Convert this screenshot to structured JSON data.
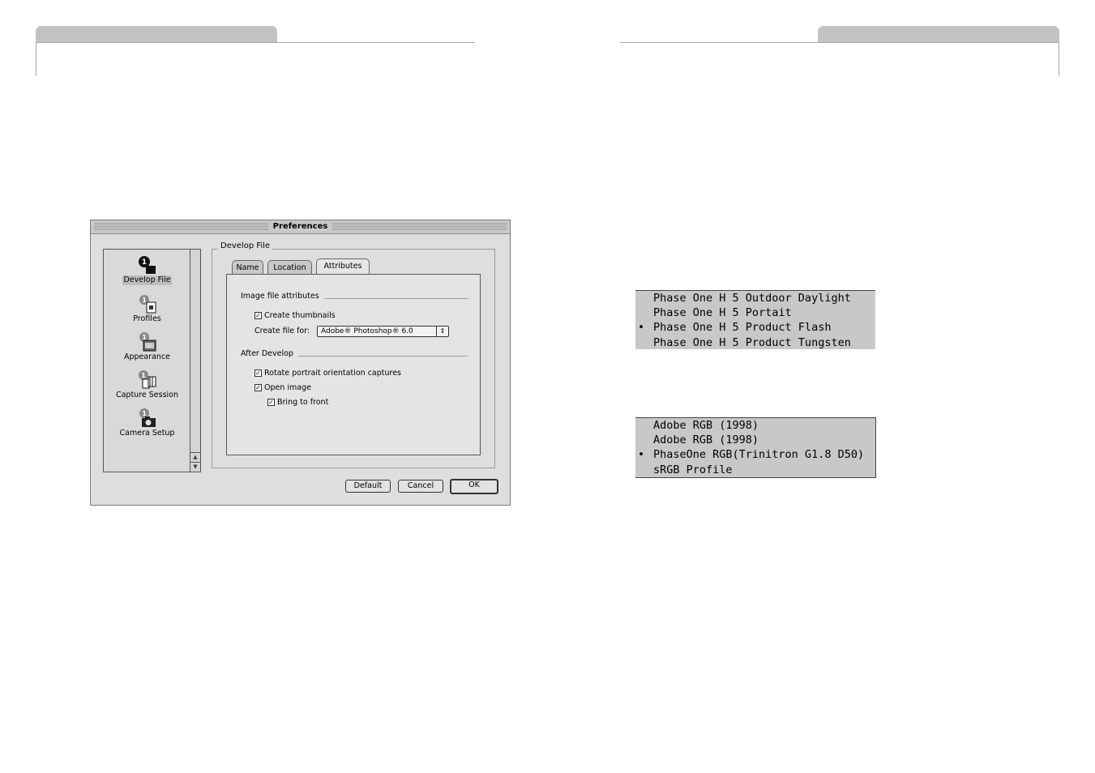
{
  "dialog": {
    "title": "Preferences",
    "sidebar": {
      "items": [
        {
          "label": "Develop File",
          "icon": "develop-file-icon",
          "selected": true
        },
        {
          "label": "Profiles",
          "icon": "profiles-icon",
          "selected": false
        },
        {
          "label": "Appearance",
          "icon": "appearance-icon",
          "selected": false
        },
        {
          "label": "Capture Session",
          "icon": "capture-session-icon",
          "selected": false
        },
        {
          "label": "Camera Setup",
          "icon": "camera-setup-icon",
          "selected": false
        }
      ]
    },
    "group_label": "Develop File",
    "tabs": [
      {
        "label": "Name",
        "active": false
      },
      {
        "label": "Location",
        "active": false
      },
      {
        "label": "Attributes",
        "active": true
      }
    ],
    "attributes": {
      "image_file_section": "Image file attributes",
      "create_thumbnails": {
        "label": "Create thumbnails",
        "checked": true
      },
      "create_file_for_label": "Create file for:",
      "create_file_for_value": "Adobe® Photoshop® 6.0",
      "after_develop_section": "After Develop",
      "rotate_portrait": {
        "label": "Rotate portrait orientation captures",
        "checked": true
      },
      "open_image": {
        "label": "Open image",
        "checked": true
      },
      "bring_to_front": {
        "label": "Bring to front",
        "checked": true
      }
    },
    "buttons": {
      "default": "Default",
      "cancel": "Cancel",
      "ok": "OK"
    }
  },
  "camera_profile_menu": {
    "items": [
      {
        "label": "Phase One H 5  Outdoor Daylight",
        "mark": ""
      },
      {
        "label": "Phase One H 5  Portait",
        "mark": ""
      },
      {
        "label": "Phase One H 5  Product Flash",
        "mark": "•"
      },
      {
        "label": "Phase One H 5  Product Tungsten",
        "mark": ""
      }
    ]
  },
  "rgb_profile_menu": {
    "items": [
      {
        "label": "Adobe RGB (1998)",
        "mark": ""
      },
      {
        "label": "Adobe RGB (1998)",
        "mark": ""
      },
      {
        "label": "PhaseOne RGB(Trinitron G1.8 D50)",
        "mark": "•"
      },
      {
        "label": "sRGB Profile",
        "mark": ""
      }
    ]
  }
}
